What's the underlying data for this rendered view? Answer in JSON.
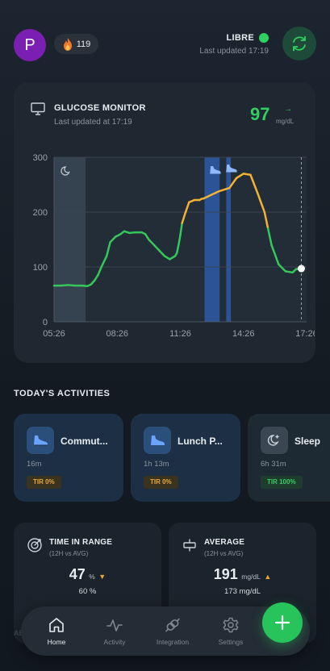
{
  "header": {
    "avatar_letter": "P",
    "streak_count": "119",
    "device_name": "LIBRE",
    "device_last_updated": "Last updated 17:19"
  },
  "glucose_monitor": {
    "title": "GLUCOSE MONITOR",
    "last_updated": "Last updated at 17:19",
    "value": "97",
    "unit": "mg/dL",
    "trend_arrow": "→"
  },
  "chart_data": {
    "type": "line",
    "x_ticks": [
      "05:26",
      "08:26",
      "11:26",
      "14:26",
      "17:26"
    ],
    "y_ticks": [
      "300",
      "200",
      "100",
      "0"
    ],
    "ylim": [
      0,
      300
    ],
    "xlim_minutes": [
      0,
      720
    ],
    "series": [
      {
        "x_minutes": [
          0,
          20,
          40,
          60,
          80,
          95,
          105,
          115,
          125,
          135,
          150,
          160,
          175,
          190,
          200,
          215,
          230,
          240,
          250,
          260,
          270,
          285,
          300,
          315,
          330,
          340,
          345,
          350,
          355,
          360,
          365,
          375,
          385,
          400,
          415,
          420,
          427,
          437,
          450,
          460,
          470,
          480,
          490,
          500,
          520,
          540,
          560,
          580,
          600,
          610,
          620,
          640,
          660,
          680,
          690,
          700,
          705
        ],
        "values": [
          66,
          66,
          67,
          66,
          66,
          65,
          68,
          75,
          85,
          100,
          120,
          145,
          155,
          160,
          165,
          162,
          163,
          163,
          163,
          160,
          150,
          140,
          130,
          120,
          114,
          118,
          120,
          125,
          140,
          158,
          180,
          200,
          218,
          222,
          222,
          224,
          225,
          228,
          232,
          235,
          238,
          240,
          242,
          244,
          262,
          270,
          268,
          235,
          200,
          170,
          140,
          105,
          92,
          90,
          96,
          97,
          97
        ]
      }
    ],
    "shaded_regions": [
      {
        "label": "sleep",
        "from": 0,
        "to": 90,
        "color": "#3a4756"
      },
      {
        "label": "commute",
        "from": 429,
        "to": 472,
        "color": "#2d5aa8"
      },
      {
        "label": "lunch",
        "from": 491,
        "to": 504,
        "color": "#2d5aa8"
      }
    ],
    "thresholds": [
      70,
      180
    ],
    "colors": {
      "in_range": "#34c85a",
      "high": "#f2b233"
    }
  },
  "activities_section": {
    "title": "TODAY'S ACTIVITIES",
    "items": [
      {
        "name": "Commut...",
        "duration": "16m",
        "tir": "TIR 0%"
      },
      {
        "name": "Lunch P...",
        "duration": "1h 13m",
        "tir": "TIR 0%"
      },
      {
        "name": "Sleep",
        "duration": "6h 31m",
        "tir": "TIR 100%"
      }
    ]
  },
  "stats": {
    "time_in_range": {
      "title": "TIME IN RANGE",
      "subtitle": "(12H vs AVG)",
      "value": "47",
      "unit": "%",
      "trend": "▼",
      "secondary": "60 %"
    },
    "average": {
      "title": "AVERAGE",
      "subtitle": "(12H vs AVG)",
      "value": "191",
      "unit": "mg/dL",
      "trend": "▲",
      "secondary": "173 mg/dL"
    }
  },
  "ghost_text": "ABILITY",
  "nav": {
    "items": [
      {
        "label": "Home"
      },
      {
        "label": "Activity"
      },
      {
        "label": "Integration"
      },
      {
        "label": "Settings"
      }
    ]
  }
}
